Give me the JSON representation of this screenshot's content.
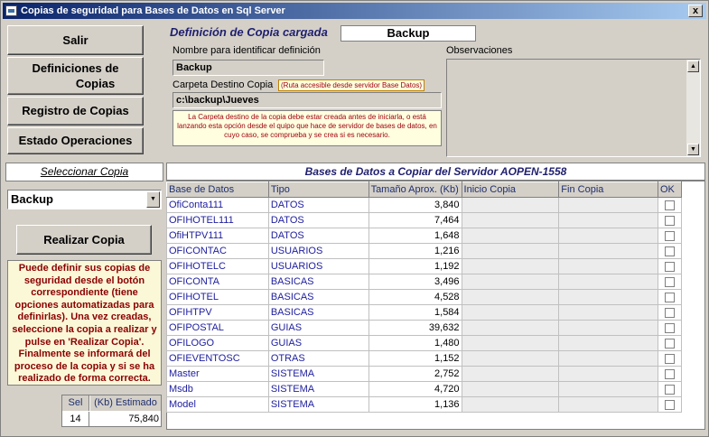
{
  "window": {
    "title": "Copias de seguridad para Bases de Datos en  Sql Server",
    "close_label": "x"
  },
  "left_buttons": {
    "exit": "Salir",
    "definitions_line1": "Definiciones de",
    "definitions_line2": "Copias",
    "registry": "Registro de Copias",
    "status": "Estado Operaciones"
  },
  "definition": {
    "header": "Definición de Copia cargada",
    "loaded_name": "Backup",
    "name_label": "Nombre para identificar definición",
    "name_value": "Backup",
    "folder_label": "Carpeta Destino Copia",
    "folder_hint": "(Ruta accesible desde servidor Base Datos)",
    "folder_value": "c:\\backup\\Jueves",
    "folder_note": "La Carpeta destino de la copia debe estar creada antes de iniciarla, o está lanzando esta opción desde el quipo que hace de servidor de bases de datos, en cuyo caso, se comprueba y se crea si es necesario.",
    "observations_label": "Observaciones",
    "observations_value": ""
  },
  "select_copy": {
    "header": "Seleccionar Copia",
    "selected": "Backup",
    "run_button": "Realizar Copia",
    "help_text": "Puede definir sus copias de seguridad desde el botón correspondiente (tiene opciones automatizadas para definirlas). Una vez creadas, seleccione la copia a realizar y pulse en 'Realizar Copia'. Finalmente se informará del proceso de la copia y si se ha realizado de forma correcta."
  },
  "summary": {
    "col_sel": "Sel",
    "col_est": "(Kb) Estimado",
    "sel": "14",
    "est": "75,840"
  },
  "grid": {
    "title": "Bases de Datos a Copiar del Servidor AOPEN-1558",
    "columns": [
      "Base de Datos",
      "Tipo",
      "Tamaño Aprox. (Kb)",
      "Inicio Copia",
      "Fin Copia",
      "OK"
    ],
    "rows": [
      {
        "db": "OfiConta111",
        "type": "DATOS",
        "size": "3,840"
      },
      {
        "db": "OFIHOTEL111",
        "type": "DATOS",
        "size": "7,464"
      },
      {
        "db": "OfiHTPV111",
        "type": "DATOS",
        "size": "1,648"
      },
      {
        "db": "OFICONTAC",
        "type": "USUARIOS",
        "size": "1,216"
      },
      {
        "db": "OFIHOTELC",
        "type": "USUARIOS",
        "size": "1,192"
      },
      {
        "db": "OFICONTA",
        "type": "BASICAS",
        "size": "3,496"
      },
      {
        "db": "OFIHOTEL",
        "type": "BASICAS",
        "size": "4,528"
      },
      {
        "db": "OFIHTPV",
        "type": "BASICAS",
        "size": "1,584"
      },
      {
        "db": "OFIPOSTAL",
        "type": "GUIAS",
        "size": "39,632"
      },
      {
        "db": "OFILOGO",
        "type": "GUIAS",
        "size": "1,480"
      },
      {
        "db": "OFIEVENTOSC",
        "type": "OTRAS",
        "size": "1,152"
      },
      {
        "db": "Master",
        "type": "SISTEMA",
        "size": "2,752"
      },
      {
        "db": "Msdb",
        "type": "SISTEMA",
        "size": "4,720"
      },
      {
        "db": "Model",
        "type": "SISTEMA",
        "size": "1,136"
      }
    ]
  }
}
